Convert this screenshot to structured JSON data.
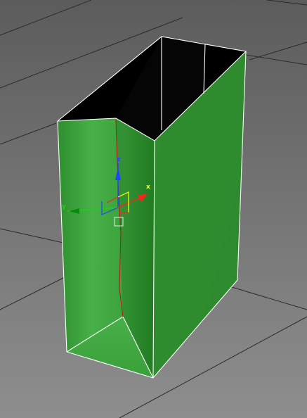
{
  "viewport": {
    "name": "perspective-viewport",
    "colors": {
      "background_top": "#5e5e5e",
      "background_bottom": "#8c8c8c",
      "grid_line": "#2a2a2a",
      "object_front": "#3a9a3a",
      "object_side": "#2f8a2f",
      "object_inner": "#000000",
      "selection_edge": "#ffffff"
    }
  },
  "gizmo": {
    "x_label": "x",
    "y_label": "y",
    "z_label": "z",
    "colors": {
      "x": "#ff2020",
      "y": "#22cc22",
      "z": "#2244ff",
      "active": "#ffff00"
    }
  }
}
